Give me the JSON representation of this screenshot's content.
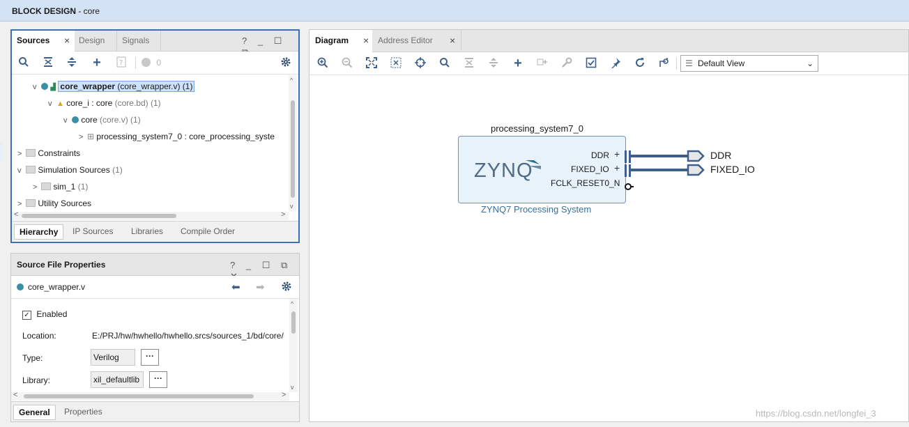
{
  "window": {
    "title_bold": "BLOCK DESIGN",
    "title_rest": " - core"
  },
  "sources": {
    "tabs": [
      "Sources",
      "Design",
      "Signals"
    ],
    "help": "?",
    "badge_count": "0",
    "tree": [
      {
        "label": "core_wrapper",
        "detail": " (core_wrapper.v) (1)"
      },
      {
        "label": "core_i : core",
        "detail": " (core.bd) (1)"
      },
      {
        "label": "core",
        "detail": " (core.v) (1)"
      },
      {
        "label": "processing_system7_0 : core_processing_syste",
        "detail": ""
      },
      {
        "label": "Constraints",
        "detail": ""
      },
      {
        "label": "Simulation Sources",
        "detail": " (1)"
      },
      {
        "label": "sim_1",
        "detail": " (1)"
      },
      {
        "label": "Utility Sources",
        "detail": ""
      }
    ],
    "bottom_tabs": [
      "Hierarchy",
      "IP Sources",
      "Libraries",
      "Compile Order"
    ]
  },
  "properties": {
    "title": "Source File Properties",
    "help": "?",
    "file": "core_wrapper.v",
    "enabled_label": "Enabled",
    "location_label": "Location:",
    "location_value": "E:/PRJ/hw/hwhello/hwhello.srcs/sources_1/bd/core/",
    "type_label": "Type:",
    "type_value": "Verilog",
    "library_label": "Library:",
    "library_value": "xil_defaultlib",
    "dots": "···",
    "bottom_tabs": [
      "General",
      "Properties"
    ]
  },
  "diagram": {
    "tabs": [
      "Diagram",
      "Address Editor"
    ],
    "view_select": "Default View",
    "block": {
      "instance": "processing_system7_0",
      "logo": "ZYNQ",
      "caption": "ZYNQ7 Processing System",
      "ports": [
        "DDR",
        "FIXED_IO",
        "FCLK_RESET0_N"
      ],
      "external_ports": [
        "DDR",
        "FIXED_IO"
      ]
    },
    "watermark": "https://blog.csdn.net/longfei_3"
  },
  "colors": {
    "accent": "#3a6fb8",
    "icon": "#3d5f8a",
    "block_fill": "#e8f2fb",
    "block_border": "#6f94bf",
    "net": "#3d5f8a"
  }
}
